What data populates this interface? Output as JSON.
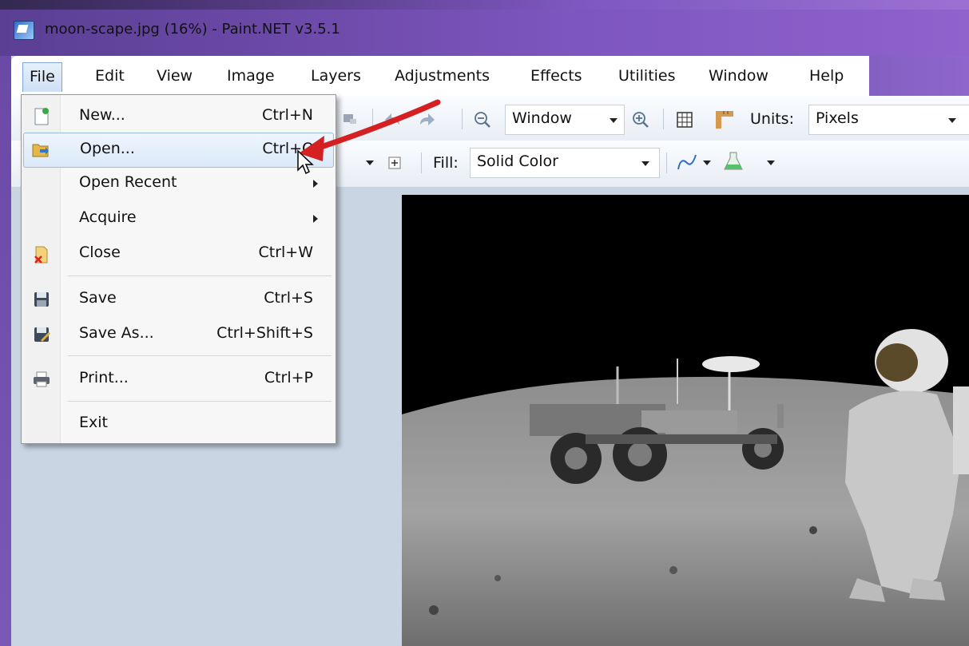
{
  "window": {
    "title": "moon-scape.jpg (16%) - Paint.NET v3.5.1"
  },
  "menubar": {
    "items": [
      "File",
      "Edit",
      "View",
      "Image",
      "Layers",
      "Adjustments",
      "Effects",
      "Utilities",
      "Window",
      "Help"
    ]
  },
  "toolbar": {
    "zoom_value": "Window",
    "units_label": "Units:",
    "units_value": "Pixels",
    "fill_label": "Fill:",
    "fill_value": "Solid Color"
  },
  "file_menu": {
    "items": [
      {
        "label": "New...",
        "shortcut": "Ctrl+N",
        "icon": "new-document-icon"
      },
      {
        "label": "Open...",
        "shortcut": "Ctrl+O",
        "icon": "open-folder-icon"
      },
      {
        "label": "Open Recent",
        "shortcut": "",
        "icon": ""
      },
      {
        "label": "Acquire",
        "shortcut": "",
        "icon": ""
      },
      {
        "label": "Close",
        "shortcut": "Ctrl+W",
        "icon": "close-document-icon"
      },
      {
        "label": "Save",
        "shortcut": "Ctrl+S",
        "icon": "save-icon"
      },
      {
        "label": "Save As...",
        "shortcut": "Ctrl+Shift+S",
        "icon": "save-as-icon"
      },
      {
        "label": "Print...",
        "shortcut": "Ctrl+P",
        "icon": "print-icon"
      },
      {
        "label": "Exit",
        "shortcut": "",
        "icon": ""
      }
    ]
  },
  "colors": {
    "titlebar": "#6c4aa8",
    "highlight": "#dbe9f9",
    "annotation_arrow": "#d42020"
  }
}
